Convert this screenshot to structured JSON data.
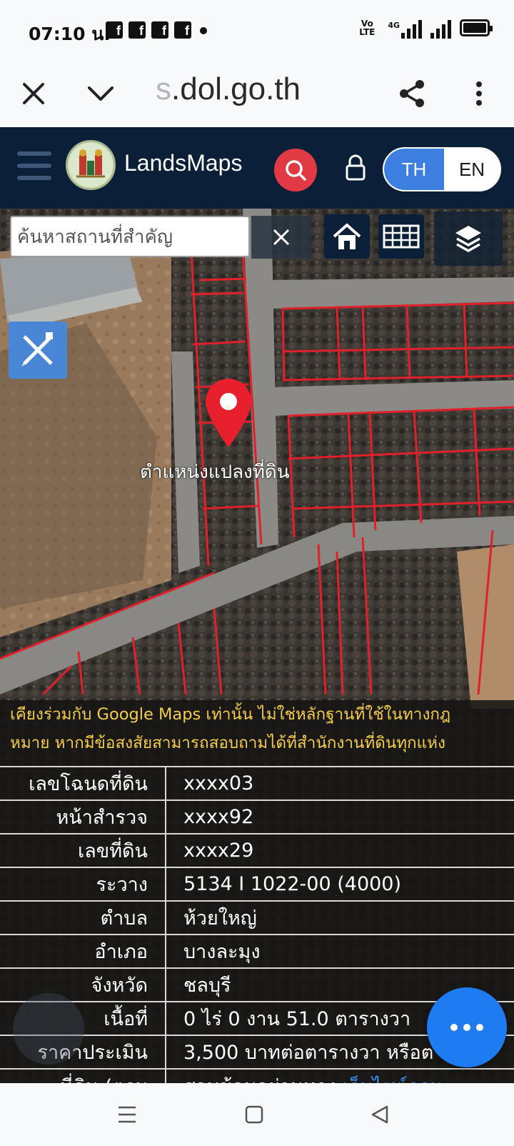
{
  "status_bar": {
    "time": "07:10 น.",
    "notification_icons": [
      "facebook-icon",
      "facebook-icon",
      "facebook-icon",
      "facebook-icon"
    ],
    "volte": "Vo LTE",
    "network": "4G"
  },
  "browser": {
    "url_faded": "s",
    "url": ".dol.go.th"
  },
  "header": {
    "brand": "LandsMaps",
    "lang_th": "TH",
    "lang_en": "EN"
  },
  "map": {
    "search_placeholder": "ค้นหาสถานที่สำคัญ",
    "pin_label": "ตำแหน่งแปลงที่ดิน"
  },
  "info": {
    "notice_line_1": "เคียงร่วมกับ Google Maps เท่านั้น ไม่ใช่หลักฐานที่ใช้ในทางกฎ",
    "notice_line_2": "หมาย หากมีข้อสงสัยสามารถสอบถามได้ที่สำนักงานที่ดินทุกแห่ง",
    "rows": [
      {
        "label": "เลขโฉนดที่ดิน",
        "value": "xxxx03"
      },
      {
        "label": "หน้าสำรวจ",
        "value": "xxxx92"
      },
      {
        "label": "เลขที่ดิน",
        "value": "xxxx29"
      },
      {
        "label": "ระวาง",
        "value": "5134 I 1022-00 (4000)"
      },
      {
        "label": "ตำบล",
        "value": "ห้วยใหญ่"
      },
      {
        "label": "อำเภอ",
        "value": "บางละมุง"
      },
      {
        "label": "จังหวัด",
        "value": "ชลบุรี"
      },
      {
        "label": "เนื้อที่",
        "value": "0 ไร่ 0 งาน 51.0 ตารางวา"
      },
      {
        "label": "ราคาประเมิน",
        "value": "3,500 บาทต่อตารางวา หรือต"
      },
      {
        "label": "ที่ดิน (ตรม",
        "value": "สอบข้อมูลผ่านทาง",
        "link": "เว็บไซต์กรม"
      }
    ]
  },
  "colors": {
    "header_bg": "#0b1f38",
    "search_button": "#e23a45",
    "lang_active": "#3d7fe0",
    "notice_text": "#f4cd4a",
    "fab": "#1e7bf2",
    "parcel_lines": "#e0202a"
  }
}
